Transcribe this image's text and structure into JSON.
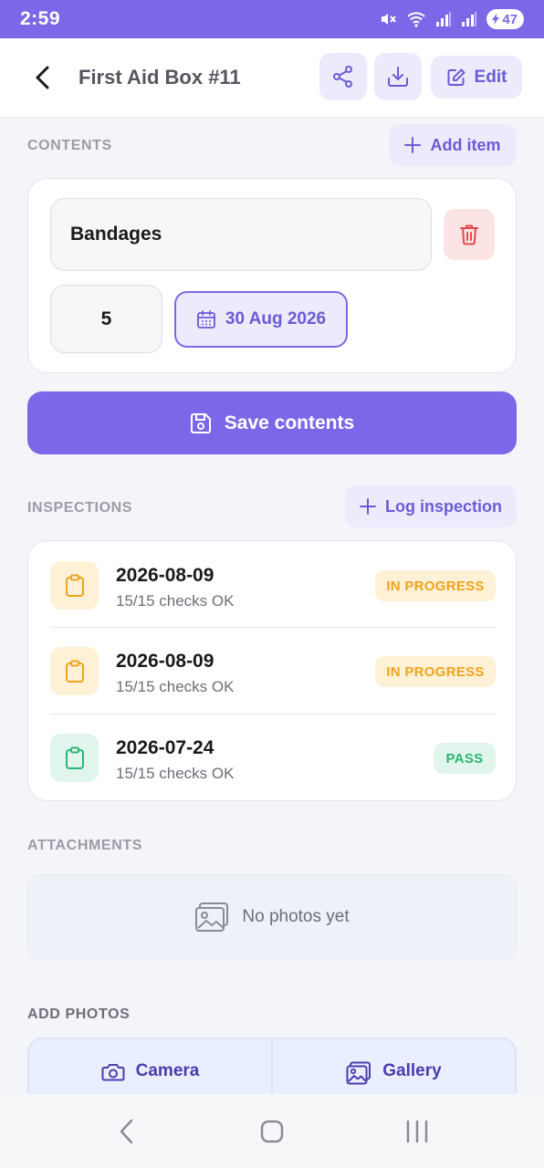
{
  "status_bar": {
    "time": "2:59",
    "battery": "47",
    "icons": [
      "mute-icon",
      "wifi-icon",
      "signal-icon",
      "signal-icon",
      "battery-icon"
    ]
  },
  "header": {
    "title": "First Aid Box #11",
    "edit_label": "Edit",
    "icons": [
      "back-arrow-icon",
      "share-icon",
      "download-icon",
      "edit-icon"
    ]
  },
  "contents": {
    "section_label": "CONTENTS",
    "add_item_label": "Add item",
    "item": {
      "name": "Bandages",
      "quantity": "5",
      "expiry_date": "30 Aug 2026"
    },
    "save_label": "Save contents"
  },
  "inspections": {
    "section_label": "INSPECTIONS",
    "log_label": "Log inspection",
    "rows": [
      {
        "date": "2026-08-09",
        "summary": "15/15 checks OK",
        "status": "IN PROGRESS",
        "status_kind": "warn"
      },
      {
        "date": "2026-08-09",
        "summary": "15/15 checks OK",
        "status": "IN PROGRESS",
        "status_kind": "warn"
      },
      {
        "date": "2026-07-24",
        "summary": "15/15 checks OK",
        "status": "PASS",
        "status_kind": "ok"
      }
    ]
  },
  "attachments": {
    "section_label": "ATTACHMENTS",
    "empty_text": "No photos yet"
  },
  "add_photos": {
    "section_label": "ADD PHOTOS",
    "camera_label": "Camera",
    "gallery_label": "Gallery"
  },
  "colors": {
    "accent": "#7b68e8",
    "accent_soft": "#ecebfc",
    "warn": "#f0a41c",
    "ok": "#2bb673",
    "danger": "#e5484d"
  }
}
